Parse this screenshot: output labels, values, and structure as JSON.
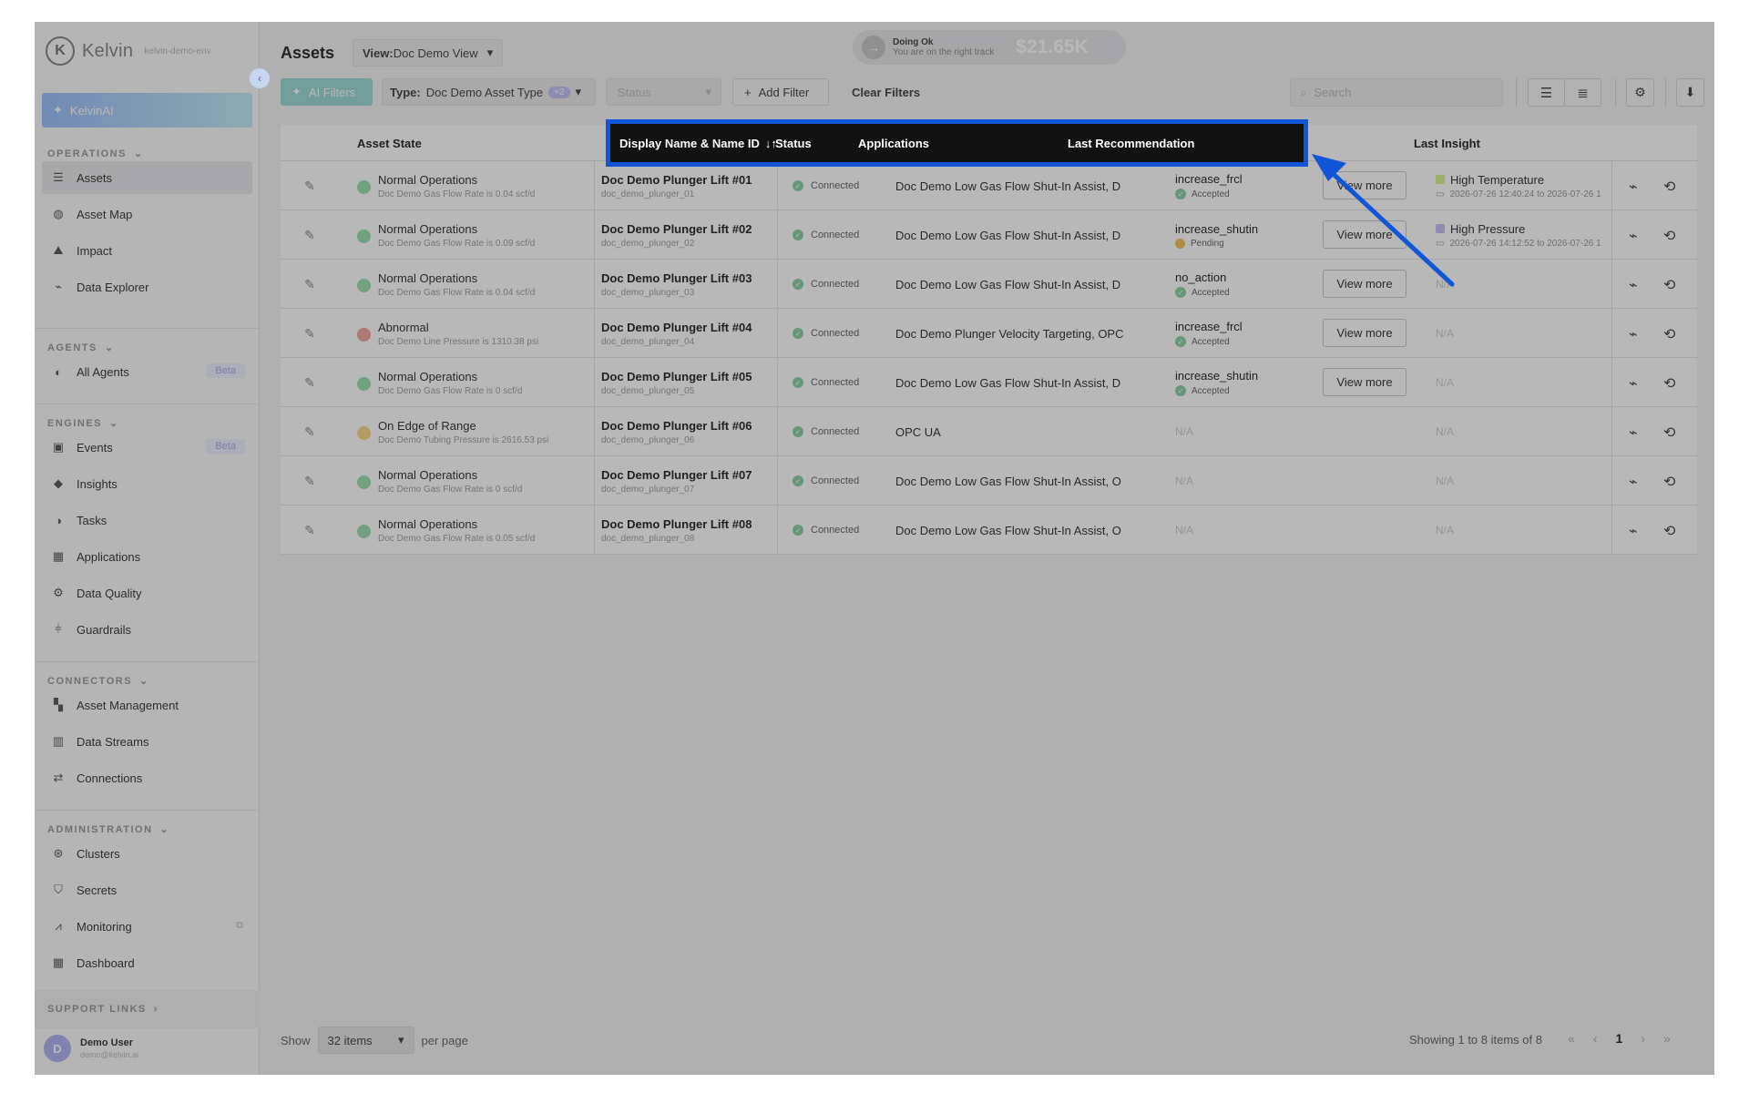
{
  "sidebar": {
    "logo_text": "Kelvin",
    "logo_sub": "kelvin-demo-env",
    "ai_button": "KelvinAI",
    "sections": {
      "operations": "OPERATIONS",
      "agents": "AGENTS",
      "engines": "ENGINES",
      "connectors": "CONNECTORS",
      "administration": "ADMINISTRATION",
      "support": "SUPPORT LINKS"
    },
    "items": {
      "assets": "Assets",
      "asset_map": "Asset Map",
      "impact": "Impact",
      "data_explorer": "Data Explorer",
      "all_agents": "All Agents",
      "events": "Events",
      "insights": "Insights",
      "tasks": "Tasks",
      "applications": "Applications",
      "data_quality": "Data Quality",
      "guardrails": "Guardrails",
      "asset_management": "Asset Management",
      "data_streams": "Data Streams",
      "connections": "Connections",
      "clusters": "Clusters",
      "secrets": "Secrets",
      "monitoring": "Monitoring",
      "dashboard": "Dashboard"
    },
    "beta": "Beta",
    "user": {
      "initial": "D",
      "name": "Demo User",
      "email": "demo@kelvin.ai"
    }
  },
  "header": {
    "title": "Assets",
    "view_prefix": "View:",
    "view_value": "Doc Demo View",
    "status_title": "Doing Ok",
    "status_sub": "You are on the right track",
    "savings": "$21.65K"
  },
  "filters": {
    "ai_filters": "AI Filters",
    "type_prefix": "Type:",
    "type_value": "Doc Demo Asset Type",
    "type_count": "+2",
    "status_placeholder": "Status",
    "add_filter": "Add Filter",
    "clear_filters": "Clear Filters",
    "search_placeholder": "Search"
  },
  "table": {
    "columns": {
      "asset_state": "Asset State",
      "display_name": "Display Name & Name ID",
      "status": "Status",
      "applications": "Applications",
      "last_recommendation": "Last Recommendation",
      "last_insight": "Last Insight"
    },
    "view_more": "View more",
    "rows": [
      {
        "state": "Normal Operations",
        "state_detail": "Doc Demo Gas Flow Rate is 0.04 scf/d",
        "state_color": "#9ee0b4",
        "name": "Doc Demo Plunger Lift #01",
        "name_id": "doc_demo_plunger_01",
        "status": "Connected",
        "apps": "Doc Demo Low Gas Flow Shut-In Assist, D",
        "rec": "increase_frcl",
        "rec_status": "Accepted",
        "rec_kind": "accepted",
        "has_view_more": true,
        "insight": "High Temperature",
        "insight_color": "#d9f28e",
        "insight_time": "2026-07-26 12:40:24 to 2026-07-26 1"
      },
      {
        "state": "Normal Operations",
        "state_detail": "Doc Demo Gas Flow Rate is 0.09 scf/d",
        "state_color": "#9ee0b4",
        "name": "Doc Demo Plunger Lift #02",
        "name_id": "doc_demo_plunger_02",
        "status": "Connected",
        "apps": "Doc Demo Low Gas Flow Shut-In Assist, D",
        "rec": "increase_shutin",
        "rec_status": "Pending",
        "rec_kind": "pending",
        "has_view_more": true,
        "insight": "High Pressure",
        "insight_color": "#c8c3f6",
        "insight_time": "2026-07-26 14:12:52 to 2026-07-26 1"
      },
      {
        "state": "Normal Operations",
        "state_detail": "Doc Demo Gas Flow Rate is 0.04 scf/d",
        "state_color": "#9ee0b4",
        "name": "Doc Demo Plunger Lift #03",
        "name_id": "doc_demo_plunger_03",
        "status": "Connected",
        "apps": "Doc Demo Low Gas Flow Shut-In Assist, D",
        "rec": "no_action",
        "rec_status": "Accepted",
        "rec_kind": "accepted",
        "has_view_more": true,
        "insight": "N/A",
        "insight_color": "",
        "insight_time": ""
      },
      {
        "state": "Abnormal",
        "state_detail": "Doc Demo Line Pressure is 1310.38 psi",
        "state_color": "#f4a5a5",
        "name": "Doc Demo Plunger Lift #04",
        "name_id": "doc_demo_plunger_04",
        "status": "Connected",
        "apps": "Doc Demo Plunger Velocity Targeting, OPC",
        "rec": "increase_frcl",
        "rec_status": "Accepted",
        "rec_kind": "accepted",
        "has_view_more": true,
        "insight": "N/A",
        "insight_color": "",
        "insight_time": ""
      },
      {
        "state": "Normal Operations",
        "state_detail": "Doc Demo Gas Flow Rate is 0 scf/d",
        "state_color": "#9ee0b4",
        "name": "Doc Demo Plunger Lift #05",
        "name_id": "doc_demo_plunger_05",
        "status": "Connected",
        "apps": "Doc Demo Low Gas Flow Shut-In Assist, D",
        "rec": "increase_shutin",
        "rec_status": "Accepted",
        "rec_kind": "accepted",
        "has_view_more": true,
        "insight": "N/A",
        "insight_color": "",
        "insight_time": ""
      },
      {
        "state": "On Edge of Range",
        "state_detail": "Doc Demo Tubing Pressure is 2616.53 psi",
        "state_color": "#f7d88a",
        "name": "Doc Demo Plunger Lift #06",
        "name_id": "doc_demo_plunger_06",
        "status": "Connected",
        "apps": "OPC UA",
        "rec": "N/A",
        "rec_status": "",
        "rec_kind": "na",
        "has_view_more": false,
        "insight": "N/A",
        "insight_color": "",
        "insight_time": ""
      },
      {
        "state": "Normal Operations",
        "state_detail": "Doc Demo Gas Flow Rate is 0 scf/d",
        "state_color": "#9ee0b4",
        "name": "Doc Demo Plunger Lift #07",
        "name_id": "doc_demo_plunger_07",
        "status": "Connected",
        "apps": "Doc Demo Low Gas Flow Shut-In Assist, O",
        "rec": "N/A",
        "rec_status": "",
        "rec_kind": "na",
        "has_view_more": false,
        "insight": "N/A",
        "insight_color": "",
        "insight_time": ""
      },
      {
        "state": "Normal Operations",
        "state_detail": "Doc Demo Gas Flow Rate is 0.05 scf/d",
        "state_color": "#9ee0b4",
        "name": "Doc Demo Plunger Lift #08",
        "name_id": "doc_demo_plunger_08",
        "status": "Connected",
        "apps": "Doc Demo Low Gas Flow Shut-In Assist, O",
        "rec": "N/A",
        "rec_status": "",
        "rec_kind": "na",
        "has_view_more": false,
        "insight": "N/A",
        "insight_color": "",
        "insight_time": ""
      }
    ]
  },
  "footer": {
    "show": "Show",
    "per_page_value": "32 items",
    "per_page": "per page",
    "showing": "Showing 1 to 8 items of 8",
    "current_page": "1"
  },
  "colors": {
    "highlight_border": "#1256d8",
    "arrow": "#1256d8",
    "connected": "#8fd1a6"
  }
}
